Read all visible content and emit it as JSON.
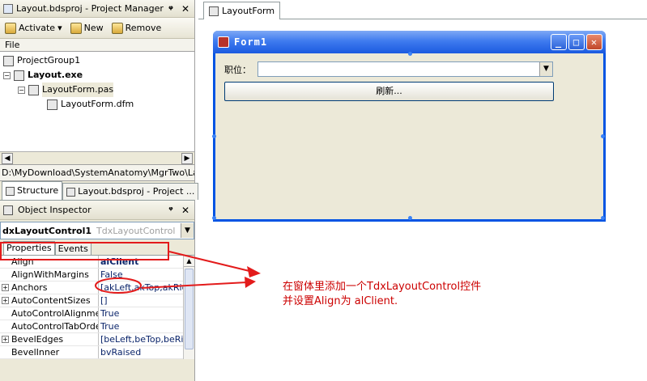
{
  "project_manager": {
    "title": "Layout.bdsproj - Project Manager",
    "pin_glyph": "ᵠ",
    "close_glyph": "✕",
    "toolbar": {
      "activate": "Activate",
      "new": "New",
      "remove": "Remove",
      "dropdown_glyph": "▾"
    },
    "file_header": "File",
    "tree": {
      "group": "ProjectGroup1",
      "project": "Layout.exe",
      "unit": "LayoutForm.pas",
      "form": "LayoutForm.dfm"
    },
    "path": "D:\\MyDownload\\SystemAnatomy\\MgrTwo\\LayoutI"
  },
  "bottom_tabs": {
    "structure": "Structure",
    "project": "Layout.bdsproj - Project ..."
  },
  "object_inspector": {
    "title": "Object Inspector",
    "component_name": "dxLayoutControl1",
    "component_class": "TdxLayoutControl",
    "tabs": {
      "properties": "Properties",
      "events": "Events"
    },
    "rows": [
      {
        "name": "Align",
        "value": "alClient",
        "expand": ""
      },
      {
        "name": "AlignWithMargins",
        "value": "False",
        "expand": ""
      },
      {
        "name": "Anchors",
        "value": "[akLeft,akTop,akRigh",
        "expand": "+"
      },
      {
        "name": "AutoContentSizes",
        "value": "[]",
        "expand": "+"
      },
      {
        "name": "AutoControlAlignment",
        "value": "True",
        "expand": ""
      },
      {
        "name": "AutoControlTabOrders",
        "value": "True",
        "expand": ""
      },
      {
        "name": "BevelEdges",
        "value": "[beLeft,beTop,beRig",
        "expand": "+"
      },
      {
        "name": "BevelInner",
        "value": "bvRaised",
        "expand": ""
      }
    ]
  },
  "designer": {
    "tab": "LayoutForm",
    "form_caption": "Form1",
    "label": "职位：",
    "button": "刷新...",
    "window_buttons": {
      "min": "_",
      "max": "□",
      "close": "✕"
    }
  },
  "annotation": {
    "line1": "在窗体里添加一个TdxLayoutControl控件",
    "line2": "并设置Align为 alClient."
  },
  "colors": {
    "annotation": "#cc0000",
    "title_blue": "#0054e3",
    "highlight": "#e31b1b"
  }
}
